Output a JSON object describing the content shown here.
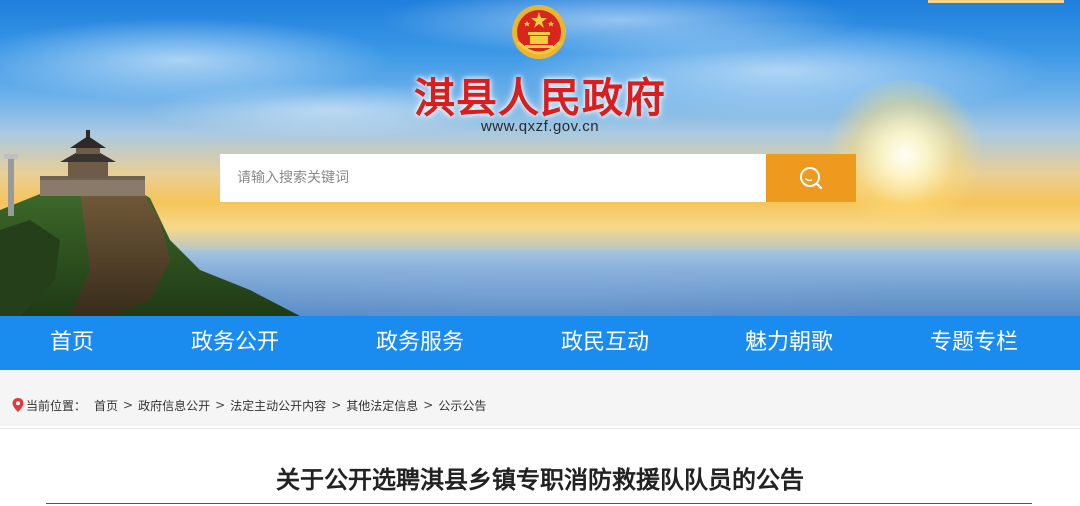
{
  "header": {
    "site_title": "淇县人民政府",
    "site_url": "www.qxzf.gov.cn",
    "emblem": "national-emblem",
    "search": {
      "placeholder": "请输入搜索关键词",
      "button_icon": "search-icon"
    }
  },
  "nav": {
    "items": [
      {
        "label": "首页"
      },
      {
        "label": "政务公开"
      },
      {
        "label": "政务服务"
      },
      {
        "label": "政民互动"
      },
      {
        "label": "魅力朝歌"
      },
      {
        "label": "专题专栏"
      }
    ]
  },
  "breadcrumb": {
    "prefix": "当前位置：",
    "items": [
      "首页",
      "政府信息公开",
      "法定主动公开内容",
      "其他法定信息",
      "公示公告"
    ],
    "separator": ">"
  },
  "article": {
    "title": "关于公开选聘淇县乡镇专职消防救援队队员的公告"
  },
  "colors": {
    "nav_bg": "#1a8cf0",
    "search_button": "#ed9a1e",
    "title_red": "#d81e1e",
    "location_pin": "#e03a3a"
  }
}
